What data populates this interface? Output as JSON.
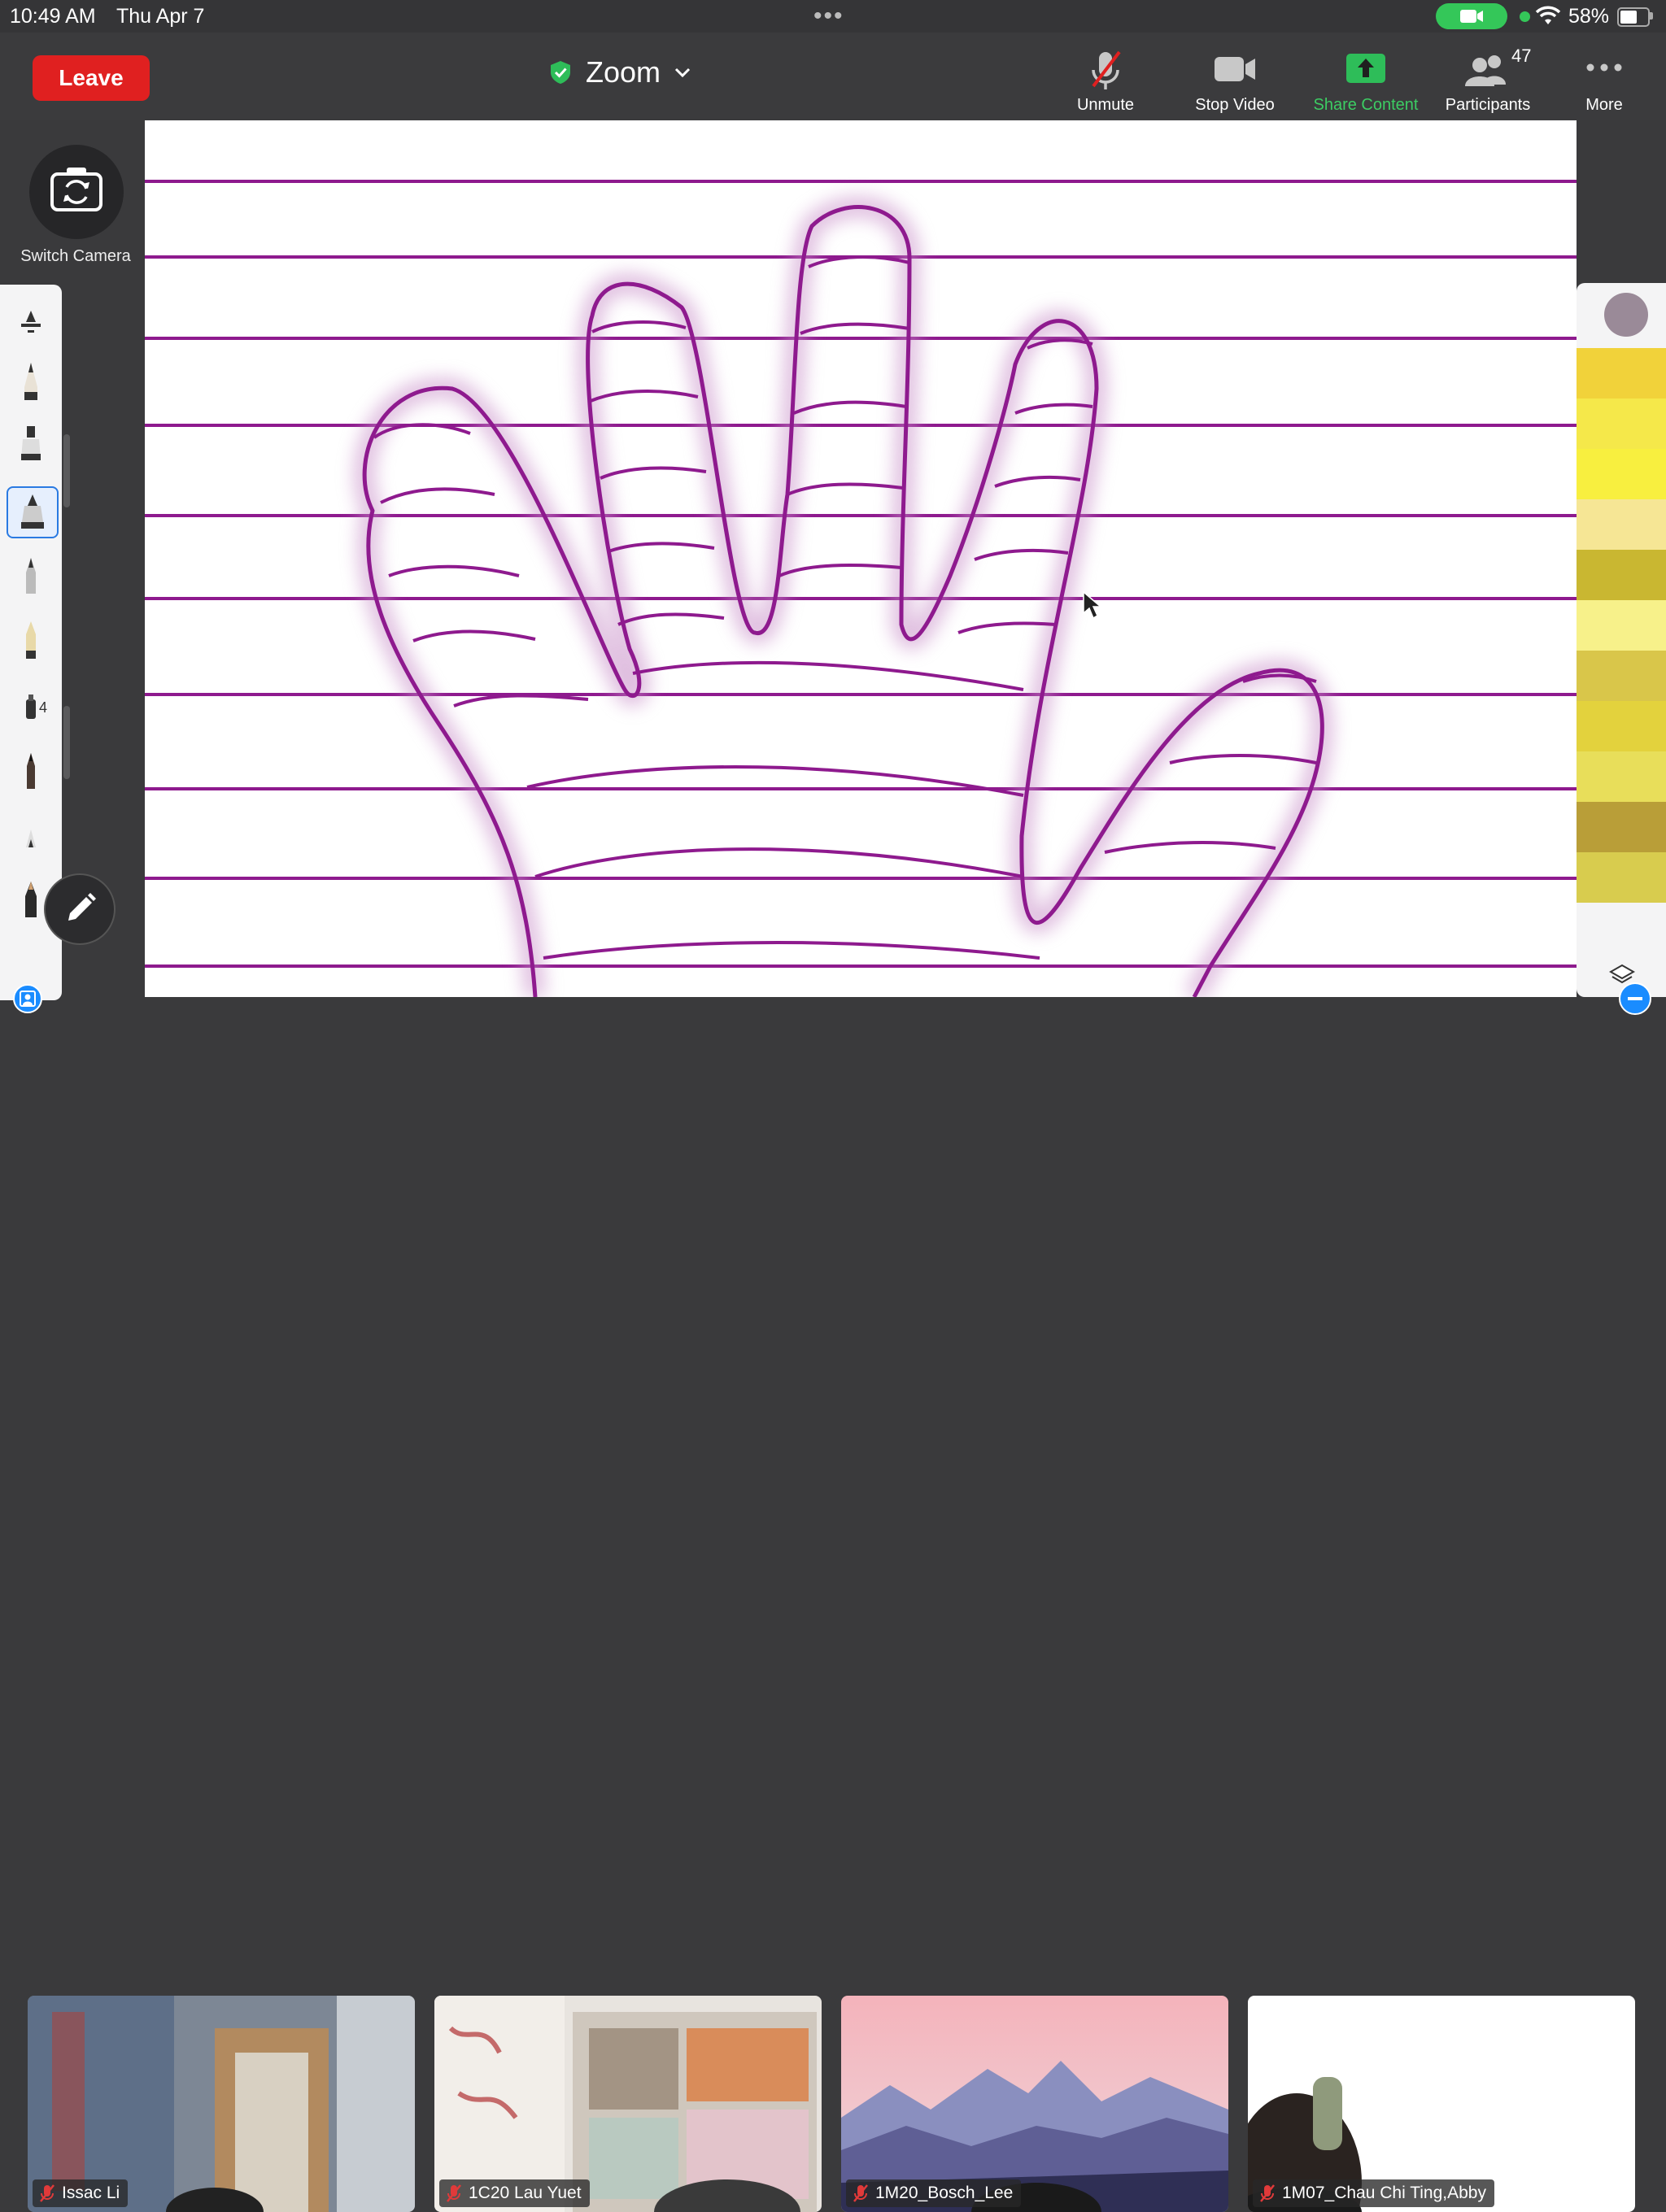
{
  "status_bar": {
    "time": "10:49 AM",
    "date": "Thu Apr 7",
    "battery": "58%"
  },
  "toolbar": {
    "leave_label": "Leave",
    "meeting_title": "Zoom",
    "unmute_label": "Unmute",
    "stop_video_label": "Stop Video",
    "share_label": "Share Content",
    "participants_label": "Participants",
    "participants_count": "47",
    "more_label": "More"
  },
  "left_panel": {
    "switch_camera_label": "Switch Camera",
    "pen_badge": "4"
  },
  "colors": {
    "ink": "#8e1a8e",
    "leave": "#e02020",
    "share": "#3ccc63",
    "accent": "#1a8cff",
    "swatches": [
      "#f1d23a",
      "#f5e84a",
      "#f8ef3f",
      "#f6e695",
      "#c9b731",
      "#f7f18a",
      "#d9c64a",
      "#e3d23d",
      "#e8de5a",
      "#b99e38",
      "#d8cc4e"
    ]
  },
  "participants": [
    {
      "name": "Issac Li",
      "muted": true
    },
    {
      "name": "1C20 Lau Yuet",
      "muted": true
    },
    {
      "name": "1M20_Bosch_Lee",
      "muted": true
    },
    {
      "name": "1M07_Chau Chi Ting,Abby",
      "muted": true
    }
  ]
}
